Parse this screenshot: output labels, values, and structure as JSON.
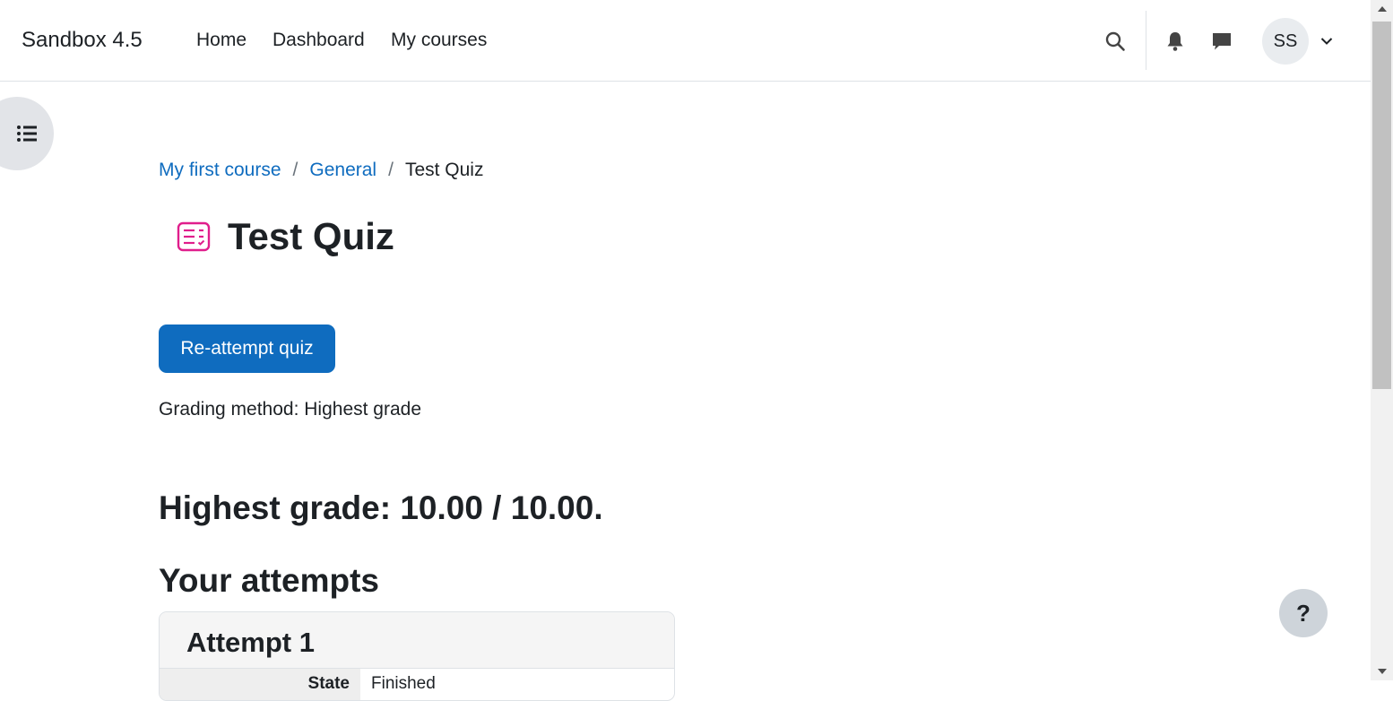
{
  "navbar": {
    "brand": "Sandbox 4.5",
    "items": [
      {
        "label": "Home"
      },
      {
        "label": "Dashboard"
      },
      {
        "label": "My courses"
      }
    ],
    "search_icon": "search-icon",
    "notifications_icon": "bell-icon",
    "messages_icon": "chat-bubble-icon",
    "user_initials": "SS",
    "user_menu_icon": "chevron-down-icon"
  },
  "drawer": {
    "icon": "list-icon"
  },
  "breadcrumb": {
    "items": [
      {
        "label": "My first course"
      },
      {
        "label": "General"
      }
    ],
    "separator": "/",
    "current": "Test Quiz"
  },
  "page": {
    "icon": "quiz-icon",
    "title": "Test Quiz",
    "reattempt_label": "Re-attempt quiz",
    "grading_method": "Grading method: Highest grade",
    "highest_grade": "Highest grade: 10.00 / 10.00.",
    "attempts_heading": "Your attempts"
  },
  "attempts": [
    {
      "title": "Attempt 1",
      "row_label": "State",
      "row_value": "Finished"
    }
  ],
  "help": {
    "label": "?"
  },
  "colors": {
    "accent": "#0f6cbf",
    "quiz_icon": "#e01e8c",
    "text": "#1d2125"
  }
}
